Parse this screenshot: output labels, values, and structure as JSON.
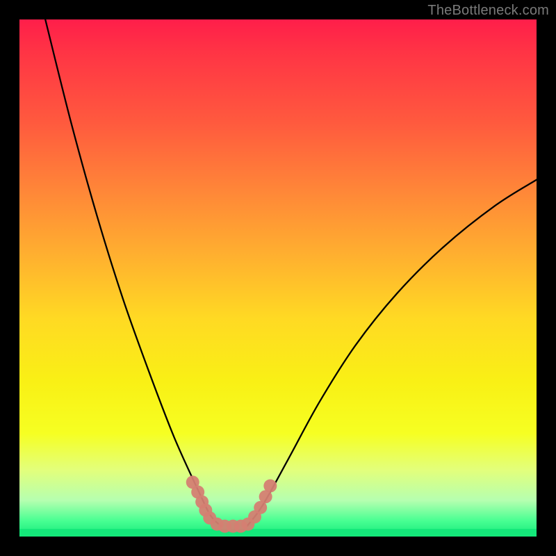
{
  "watermark": "TheBottleneck.com",
  "chart_data": {
    "type": "line",
    "title": "",
    "xlabel": "",
    "ylabel": "",
    "xlim": [
      0,
      100
    ],
    "ylim": [
      0,
      100
    ],
    "notes": "No numeric axes, tick labels, or legend are rendered in the screenshot. Curve values are estimated from pixel positions in a 744x744 plot area; y is measured from the bottom edge.",
    "series": [
      {
        "name": "left-curve",
        "x": [
          5,
          10,
          15,
          20,
          25,
          30,
          35,
          37,
          39
        ],
        "y": [
          100,
          80,
          62,
          46,
          32,
          19,
          8,
          4,
          2
        ]
      },
      {
        "name": "right-curve",
        "x": [
          44,
          47,
          52,
          58,
          65,
          73,
          82,
          92,
          100
        ],
        "y": [
          2,
          6,
          15,
          26,
          37,
          47,
          56,
          64,
          69
        ]
      }
    ],
    "floor_band": {
      "name": "green-floor",
      "y_range": [
        0,
        2
      ]
    },
    "markers": {
      "name": "salmon-dots",
      "points": [
        {
          "x": 33.5,
          "y": 10.5
        },
        {
          "x": 34.5,
          "y": 8.6
        },
        {
          "x": 35.3,
          "y": 6.7
        },
        {
          "x": 36.0,
          "y": 5.1
        },
        {
          "x": 36.8,
          "y": 3.6
        },
        {
          "x": 38.2,
          "y": 2.4
        },
        {
          "x": 39.7,
          "y": 2.0
        },
        {
          "x": 41.3,
          "y": 2.0
        },
        {
          "x": 42.8,
          "y": 2.0
        },
        {
          "x": 44.2,
          "y": 2.4
        },
        {
          "x": 45.5,
          "y": 3.8
        },
        {
          "x": 46.6,
          "y": 5.6
        },
        {
          "x": 47.6,
          "y": 7.7
        },
        {
          "x": 48.5,
          "y": 9.8
        }
      ]
    }
  }
}
